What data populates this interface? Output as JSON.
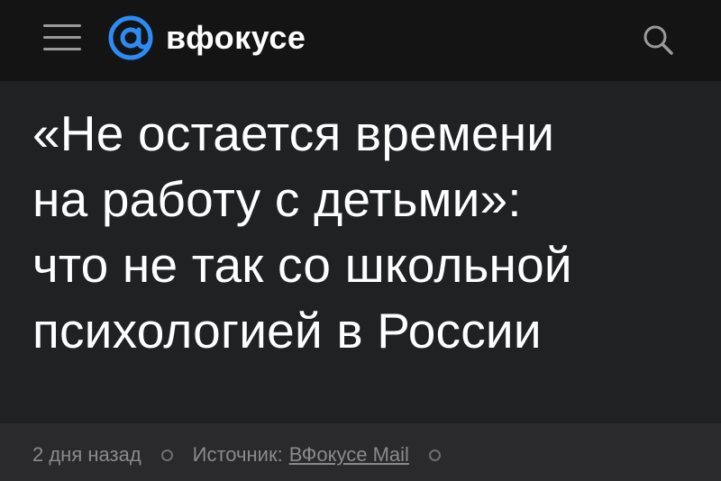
{
  "header": {
    "menu_icon": "hamburger-menu-icon",
    "logo_icon": "at-sign-icon",
    "logo_text": "вфокусе",
    "search_icon": "search-icon",
    "accent_color": "#2c8cf4"
  },
  "article": {
    "headline_lines": [
      "«Не остается времени",
      "на работу с детьми»:",
      "что не так со школьной",
      "психологией в России"
    ]
  },
  "meta": {
    "date": "2 дня назад",
    "source_label": "Источник:",
    "source_link": "ВФокусе Mail"
  }
}
